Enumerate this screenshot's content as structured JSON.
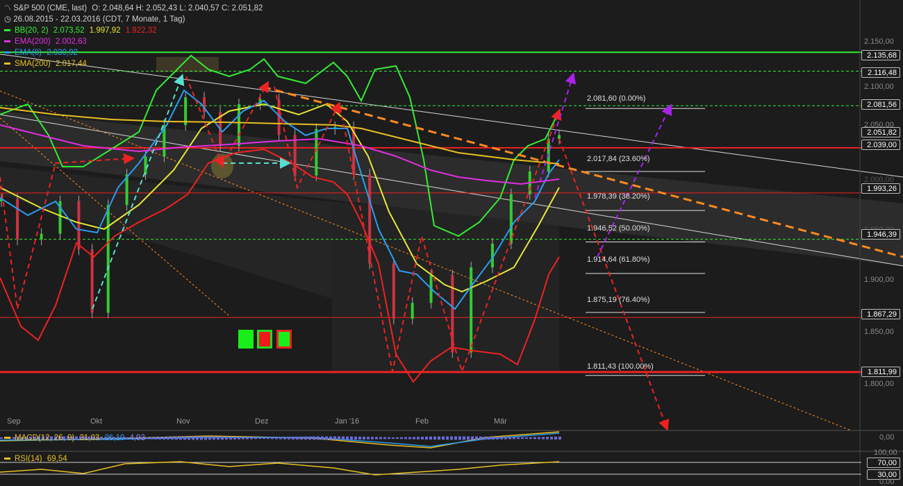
{
  "header": {
    "symbol": "S&P 500 (CME, last)",
    "ohlc": "O: 2.048,64  H: 2.052,43  L: 2.040,57  C: 2.051,82",
    "range": "26.08.2015 - 22.03.2016 (CDT, 7 Monate, 1 Tag)"
  },
  "legend": [
    {
      "name": "BB(20, 2)",
      "values": [
        "2.073,52",
        "1.997,92",
        "1.922,32"
      ],
      "colors": [
        "#33ee33",
        "#e8e838",
        "#ee2222"
      ]
    },
    {
      "name": "EMA(200)",
      "values": [
        "2.002,63"
      ],
      "colors": [
        "#e22ee2"
      ]
    },
    {
      "name": "EMA(8)",
      "values": [
        "2.030,92"
      ],
      "colors": [
        "#2a9df4"
      ]
    },
    {
      "name": "SMA(200)",
      "values": [
        "2.017,44"
      ],
      "colors": [
        "#e8c020"
      ]
    }
  ],
  "price_axis_ticks": [
    "2.150,00",
    "2.100,00",
    "2.050,00",
    "2.000,00",
    "1.950,00",
    "1.900,00",
    "1.850,00",
    "1.800,00"
  ],
  "price_boxes": [
    "2.135,68",
    "2.116,48",
    "2.081,56",
    "2.051,82",
    "2.039,00",
    "1.993,26",
    "1.946,39",
    "1.867,29",
    "1.811,99"
  ],
  "fibonacci": [
    {
      "level": "2.081,60 (0.00%)",
      "price": 2081.6
    },
    {
      "level": "2.017,84 (23.60%)",
      "price": 2017.84
    },
    {
      "level": "1.978,39 (38.20%)",
      "price": 1978.39
    },
    {
      "level": "1.946,52 (50.00%)",
      "price": 1946.52
    },
    {
      "level": "1.914,64 (61.80%)",
      "price": 1914.64
    },
    {
      "level": "1.875,19 (76.40%)",
      "price": 1875.19
    },
    {
      "level": "1.811,43 (100.00%)",
      "price": 1811.43
    }
  ],
  "x_axis_labels": [
    "Sep",
    "Okt",
    "Nov",
    "Dez",
    "Jan '16",
    "Feb",
    "Mär"
  ],
  "macd": {
    "label": "MACD(12, 26, 9)",
    "values": [
      "31,03",
      "26,10",
      "4,93"
    ],
    "axis": "0,00"
  },
  "rsi": {
    "label": "RSI(14)",
    "value": "69,54",
    "axis": [
      "100,00",
      "70,00",
      "30,00",
      "0,00"
    ]
  },
  "colors": {
    "background": "#1c1c1c",
    "bb_upper": "#33ee33",
    "bb_mid": "#e8e838",
    "bb_lower": "#ee2222",
    "ema200": "#e22ee2",
    "ema8": "#2a9df4",
    "sma200": "#e8c020",
    "trend": "#ff8a1e",
    "arrow_red": "#ee2222",
    "arrow_purple": "#aa22ee",
    "arrow_cyan": "#55e0d0"
  },
  "chart_data": {
    "type": "candlestick",
    "title": "S&P 500 (CME, last)",
    "ylim": [
      1780,
      2160
    ],
    "x_range": [
      "2015-08-26",
      "2016-03-22"
    ],
    "horizontal_levels": [
      2135.68,
      2116.48,
      2081.56,
      2039.0,
      1993.26,
      1946.39,
      1867.29,
      1811.99
    ],
    "series": [
      {
        "name": "S&P 500",
        "dates": [
          "2015-08-26",
          "2015-09-01",
          "2015-09-10",
          "2015-09-17",
          "2015-09-24",
          "2015-09-29",
          "2015-10-05",
          "2015-10-12",
          "2015-10-19",
          "2015-10-26",
          "2015-11-03",
          "2015-11-10",
          "2015-11-16",
          "2015-11-23",
          "2015-12-01",
          "2015-12-08",
          "2015-12-14",
          "2015-12-22",
          "2015-12-29",
          "2016-01-05",
          "2016-01-11",
          "2016-01-20",
          "2016-01-27",
          "2016-02-03",
          "2016-02-11",
          "2016-02-18",
          "2016-02-26",
          "2016-03-04",
          "2016-03-11",
          "2016-03-18",
          "2016-03-22"
        ],
        "close": [
          1987,
          1946,
          1952,
          1985,
          1936,
          1872,
          1981,
          2012,
          2030,
          2062,
          2090,
          2075,
          2041,
          2083,
          2088,
          2052,
          2011,
          2058,
          2060,
          2012,
          1922,
          1866,
          1882,
          1910,
          1832,
          1918,
          1942,
          1992,
          2015,
          2048,
          2051.82
        ]
      },
      {
        "name": "BB(20, 2)",
        "values": [
          2073.52,
          1997.92,
          1922.32
        ]
      },
      {
        "name": "EMA(200)",
        "values": [
          2002.63
        ]
      },
      {
        "name": "EMA(8)",
        "values": [
          2030.92
        ]
      },
      {
        "name": "SMA(200)",
        "values": [
          2017.44
        ]
      }
    ]
  }
}
